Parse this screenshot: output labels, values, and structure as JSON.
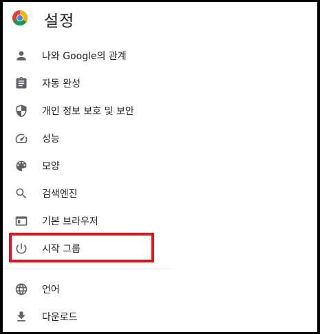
{
  "header": {
    "title": "설정",
    "logo_icon": "chrome-logo-icon"
  },
  "menu": {
    "items": [
      {
        "label": "나와 Google의 관계",
        "icon": "person-icon"
      },
      {
        "label": "자동 완성",
        "icon": "clipboard-icon"
      },
      {
        "label": "개인 정보 보호 및 보안",
        "icon": "shield-icon"
      },
      {
        "label": "성능",
        "icon": "speedometer-icon"
      },
      {
        "label": "모양",
        "icon": "palette-icon"
      },
      {
        "label": "검색엔진",
        "icon": "search-icon"
      },
      {
        "label": "기본 브라우저",
        "icon": "browser-window-icon"
      },
      {
        "label": "시작 그룹",
        "icon": "power-icon"
      },
      {
        "label": "언어",
        "icon": "globe-icon"
      },
      {
        "label": "다운로드",
        "icon": "download-icon"
      }
    ]
  },
  "colors": {
    "highlight": "#e3131e",
    "icon": "#5f6368",
    "text": "#202124"
  }
}
